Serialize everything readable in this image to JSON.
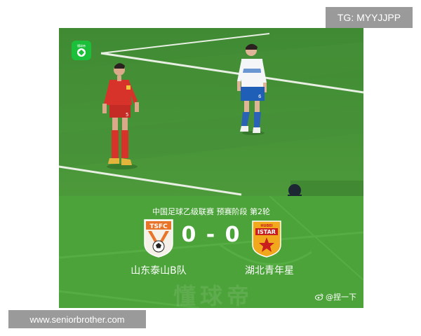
{
  "watermarks": {
    "telegram": "TG: MYYJJPP",
    "site": "www.seniorbrother.com"
  },
  "app_icon": {
    "name": "dongqiudi-app-icon",
    "text": "懂球帝"
  },
  "match": {
    "title": "中国足球乙级联赛 预赛阶段 第2轮",
    "score": "0 - 0",
    "home_team": "山东泰山B队",
    "away_team": "湖北青年星",
    "home_crest_text": "TSFC",
    "away_crest_text": "ISTAR",
    "away_crest_top": "HUBEI"
  },
  "panel_watermark": "懂球帝",
  "credit": {
    "icon": "weibo-icon",
    "handle": "@捏一下"
  },
  "colors": {
    "pitch": "#4ca33a",
    "home_kit": "#d8332b",
    "away_kit": "#ffffff",
    "away_crest": "#f2a81d"
  }
}
